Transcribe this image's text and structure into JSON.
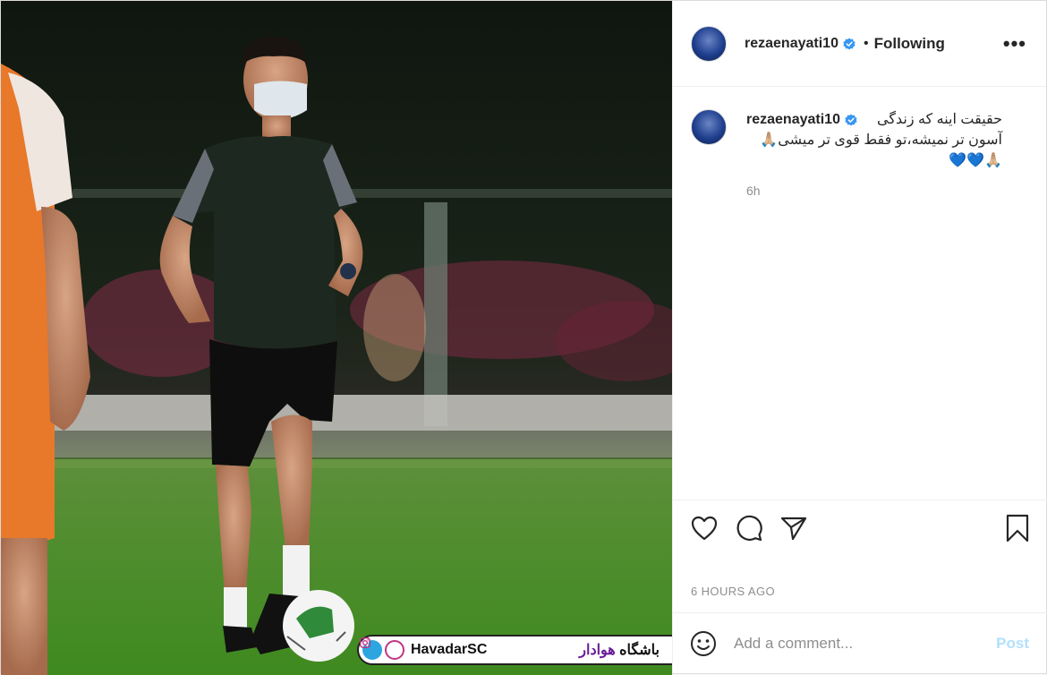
{
  "post": {
    "username": "rezaenayati10",
    "follow_status": "Following",
    "more_label": "•••",
    "separator": "•",
    "caption": "حقیقت اینه که زندگی\nآسون تر نمیشه،تو فقط قوی تر میشی🙏🏼\n🙏🏼💙💙",
    "caption_age": "6h",
    "timestamp": "6 HOURS AGO",
    "comment_placeholder": "Add a comment...",
    "post_button": "Post",
    "watermark_handle": "HavadarSC",
    "watermark_text_prefix": "باشگاه ",
    "watermark_text_accent": "هوادار",
    "colors": {
      "verified": "#3897f0",
      "post_button_disabled": "#b2dffc",
      "secondary_text": "#8e8e8e"
    },
    "icons": [
      "more-options-icon",
      "verified-badge-icon",
      "heart-icon",
      "comment-icon",
      "share-icon",
      "bookmark-icon",
      "emoji-icon",
      "telegram-icon",
      "instagram-icon"
    ]
  }
}
